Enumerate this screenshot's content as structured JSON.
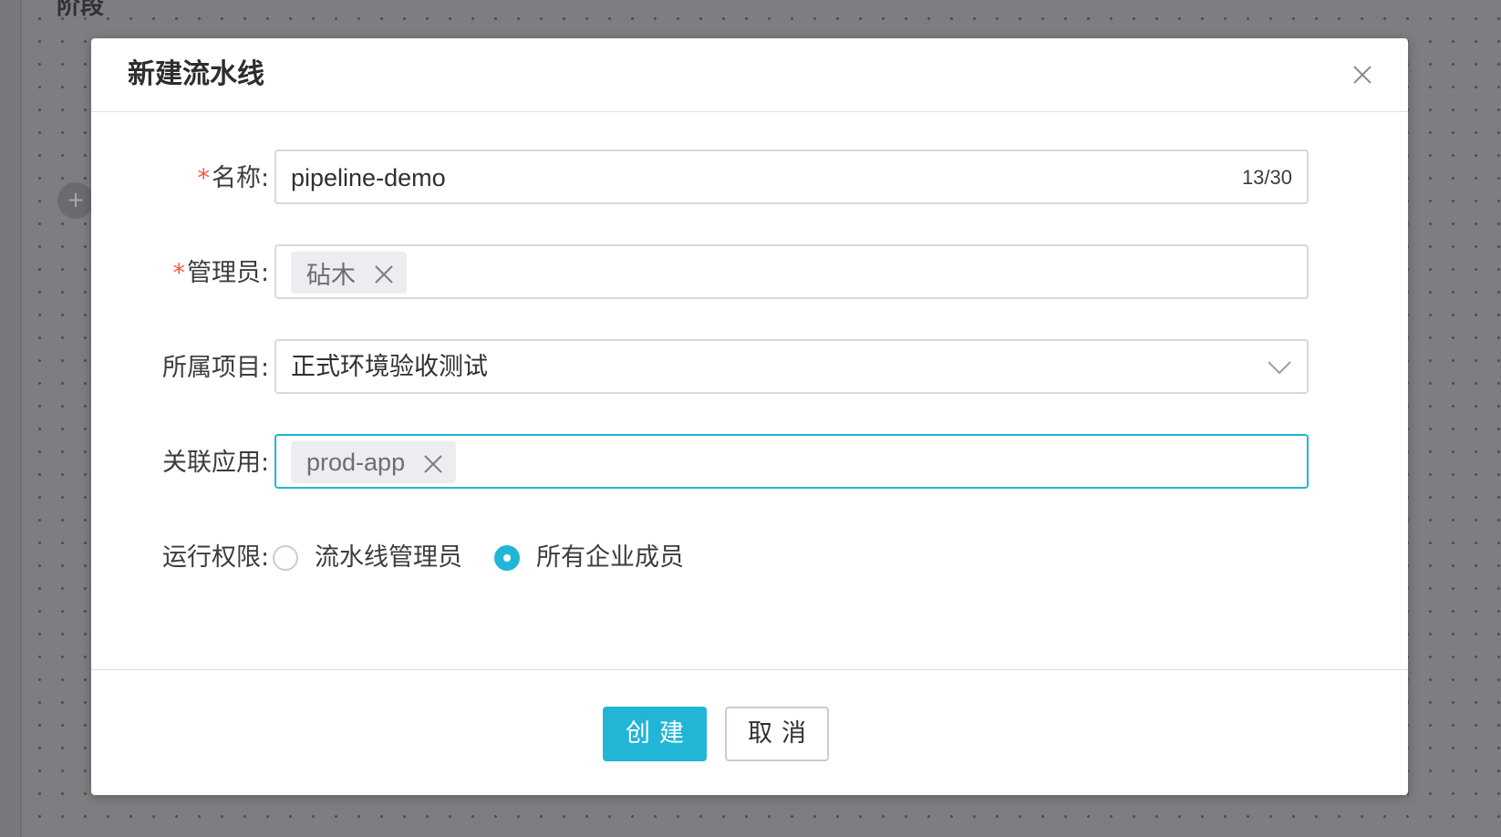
{
  "background": {
    "stage_title": "阶段",
    "add_node_symbol": "+"
  },
  "dialog": {
    "title": "新建流水线",
    "close_icon": "close-icon"
  },
  "form": {
    "name": {
      "required_mark": "*",
      "label": "名称",
      "colon": ":",
      "value": "pipeline-demo",
      "counter": "13/30"
    },
    "admin": {
      "required_mark": "*",
      "label": "管理员",
      "colon": ":",
      "tags": [
        "砧木"
      ]
    },
    "project": {
      "label": "所属项目",
      "colon": ":",
      "selected": "正式环境验收测试",
      "arrow_icon": "chevron-down-icon"
    },
    "app": {
      "label": "关联应用",
      "colon": ":",
      "tags": [
        "prod-app"
      ],
      "focused": true
    },
    "permission": {
      "label": "运行权限",
      "colon": ":",
      "options": [
        {
          "label": "流水线管理员",
          "checked": false
        },
        {
          "label": "所有企业成员",
          "checked": true
        }
      ]
    }
  },
  "footer": {
    "create_label": "创建",
    "cancel_label": "取消"
  },
  "colors": {
    "accent": "#21b6d6",
    "required": "#f25a3b",
    "overlay": "#7d7e81"
  }
}
